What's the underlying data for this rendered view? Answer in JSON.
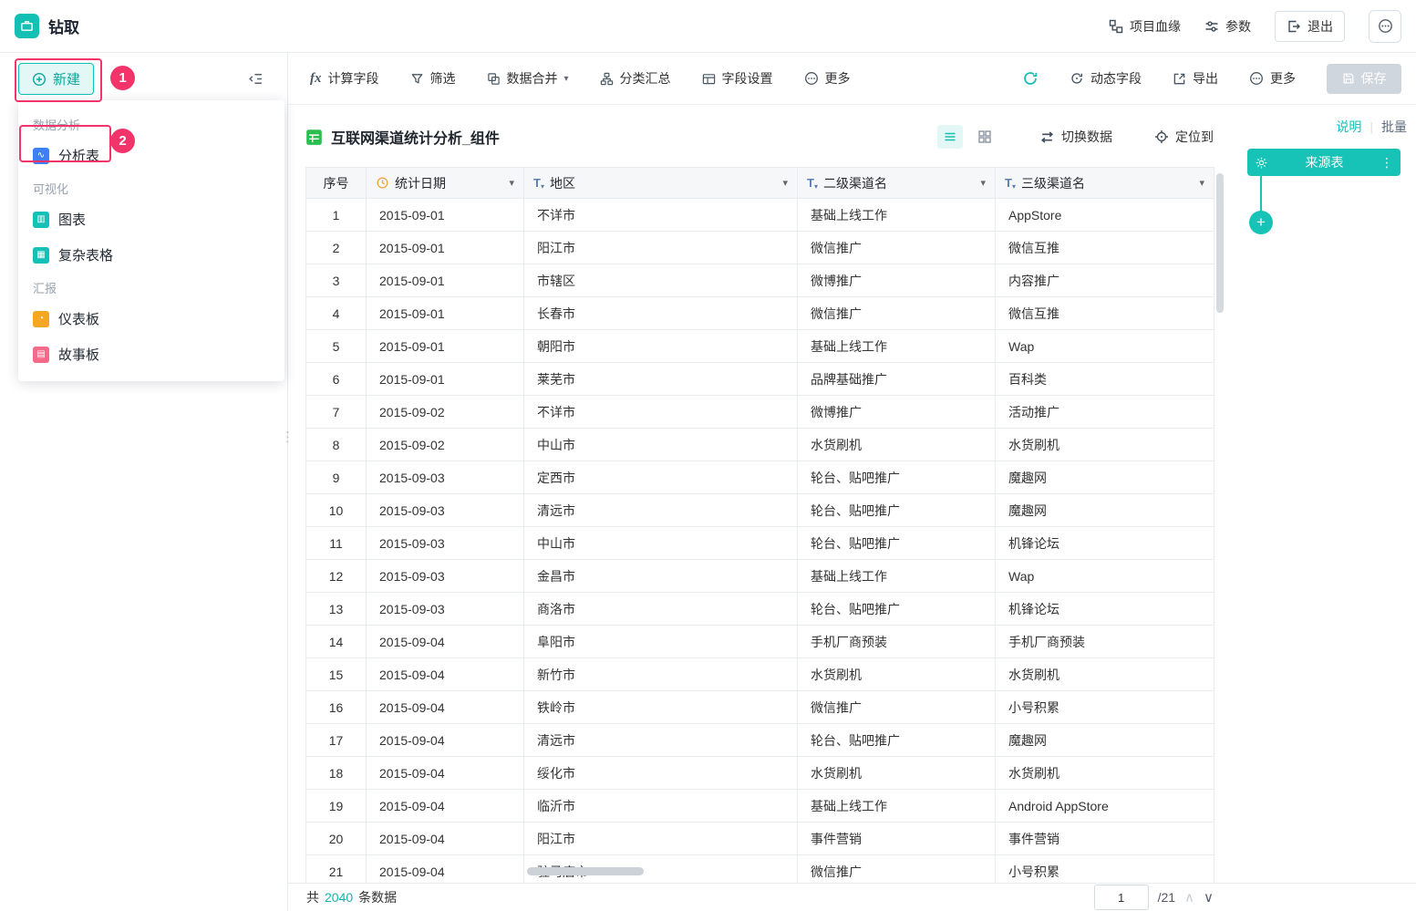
{
  "header": {
    "title": "钻取",
    "lineage": "项目血缘",
    "params": "参数",
    "exit": "退出"
  },
  "sidebar": {
    "new_label": "新建",
    "menu": {
      "sections": [
        {
          "title": "数据分析",
          "items": [
            {
              "label": "分析表",
              "icon": "analysis-table-icon",
              "color": "#3d7ff7",
              "glyph": "∿"
            }
          ]
        },
        {
          "title": "可视化",
          "items": [
            {
              "label": "图表",
              "icon": "chart-icon",
              "color": "#14c1b6",
              "glyph": "▥"
            },
            {
              "label": "复杂表格",
              "icon": "complex-table-icon",
              "color": "#14c1b6",
              "glyph": "▦"
            }
          ]
        },
        {
          "title": "汇报",
          "items": [
            {
              "label": "仪表板",
              "icon": "dashboard-icon",
              "color": "#f5a623",
              "glyph": "◔"
            },
            {
              "label": "故事板",
              "icon": "storyboard-icon",
              "color": "#f56989",
              "glyph": "▤"
            }
          ]
        }
      ]
    }
  },
  "annotations": {
    "step1": "1",
    "step2": "2"
  },
  "toolbar": {
    "calc_field": "计算字段",
    "filter": "筛选",
    "merge": "数据合并",
    "summary": "分类汇总",
    "field_settings": "字段设置",
    "more_left": "更多",
    "dynamic_field": "动态字段",
    "export": "导出",
    "more_right": "更多",
    "save": "保存"
  },
  "content": {
    "title": "互联网渠道统计分析_组件",
    "switch_data": "切换数据",
    "locate": "定位到"
  },
  "right_panel": {
    "note": "说明",
    "batch": "批量",
    "source_table": "来源表"
  },
  "table": {
    "columns": [
      "序号",
      "统计日期",
      "地区",
      "二级渠道名",
      "三级渠道名"
    ],
    "rows": [
      [
        "1",
        "2015-09-01",
        "不详市",
        "基础上线工作",
        "AppStore"
      ],
      [
        "2",
        "2015-09-01",
        "阳江市",
        "微信推广",
        "微信互推"
      ],
      [
        "3",
        "2015-09-01",
        "市辖区",
        "微博推广",
        "内容推广"
      ],
      [
        "4",
        "2015-09-01",
        "长春市",
        "微信推广",
        "微信互推"
      ],
      [
        "5",
        "2015-09-01",
        "朝阳市",
        "基础上线工作",
        "Wap"
      ],
      [
        "6",
        "2015-09-01",
        "莱芜市",
        "品牌基础推广",
        "百科类"
      ],
      [
        "7",
        "2015-09-02",
        "不详市",
        "微博推广",
        "活动推广"
      ],
      [
        "8",
        "2015-09-02",
        "中山市",
        "水货刷机",
        "水货刷机"
      ],
      [
        "9",
        "2015-09-03",
        "定西市",
        "轮台、贴吧推广",
        "魔趣网"
      ],
      [
        "10",
        "2015-09-03",
        "清远市",
        "轮台、贴吧推广",
        "魔趣网"
      ],
      [
        "11",
        "2015-09-03",
        "中山市",
        "轮台、贴吧推广",
        "机锋论坛"
      ],
      [
        "12",
        "2015-09-03",
        "金昌市",
        "基础上线工作",
        "Wap"
      ],
      [
        "13",
        "2015-09-03",
        "商洛市",
        "轮台、贴吧推广",
        "机锋论坛"
      ],
      [
        "14",
        "2015-09-04",
        "阜阳市",
        "手机厂商预装",
        "手机厂商预装"
      ],
      [
        "15",
        "2015-09-04",
        "新竹市",
        "水货刷机",
        "水货刷机"
      ],
      [
        "16",
        "2015-09-04",
        "铁岭市",
        "微信推广",
        "小号积累"
      ],
      [
        "17",
        "2015-09-04",
        "清远市",
        "轮台、贴吧推广",
        "魔趣网"
      ],
      [
        "18",
        "2015-09-04",
        "绥化市",
        "水货刷机",
        "水货刷机"
      ],
      [
        "19",
        "2015-09-04",
        "临沂市",
        "基础上线工作",
        "Android AppStore"
      ],
      [
        "20",
        "2015-09-04",
        "阳江市",
        "事件营销",
        "事件营销"
      ],
      [
        "21",
        "2015-09-04",
        "驻马店市",
        "微信推广",
        "小号积累"
      ]
    ]
  },
  "footer": {
    "total_prefix": "共",
    "total_count": "2040",
    "total_suffix": "条数据",
    "page": "1",
    "page_total": "/21"
  },
  "icons": {
    "caret_down": "▾",
    "text_filter": "T",
    "fx": "fx",
    "plus": "+",
    "dots_vertical": "⋮",
    "chevron_up": "∧",
    "chevron_down": "∨",
    "divider": "|",
    "resize_dots": "⋮"
  },
  "colors": {
    "accent": "#14c0b4",
    "annotation": "#f2346b",
    "save_disabled": "#cfd6dd"
  }
}
